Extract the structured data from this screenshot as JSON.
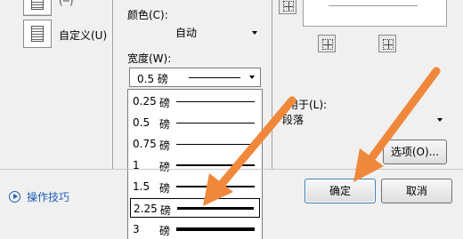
{
  "setting": {
    "custom_label": "自定义(U)"
  },
  "color": {
    "label": "颜色(C):",
    "value": "自动"
  },
  "width": {
    "label": "宽度(W):",
    "value": "0.5  磅",
    "options": [
      {
        "value": "0.25",
        "unit": "磅",
        "thickness": 1
      },
      {
        "value": "0.5",
        "unit": "磅",
        "thickness": 1
      },
      {
        "value": "0.75",
        "unit": "磅",
        "thickness": 1
      },
      {
        "value": "1",
        "unit": "磅",
        "thickness": 2
      },
      {
        "value": "1.5",
        "unit": "磅",
        "thickness": 2
      },
      {
        "value": "2.25",
        "unit": "磅",
        "thickness": 3,
        "selected": true
      },
      {
        "value": "3",
        "unit": "磅",
        "thickness": 4
      }
    ]
  },
  "apply_to": {
    "label": "用于(L):",
    "value": "段落"
  },
  "buttons": {
    "options": "选项(O)...",
    "ok": "确定",
    "cancel": "取消"
  },
  "tips_link": "操作技巧",
  "annotation_color": "#f0883c"
}
